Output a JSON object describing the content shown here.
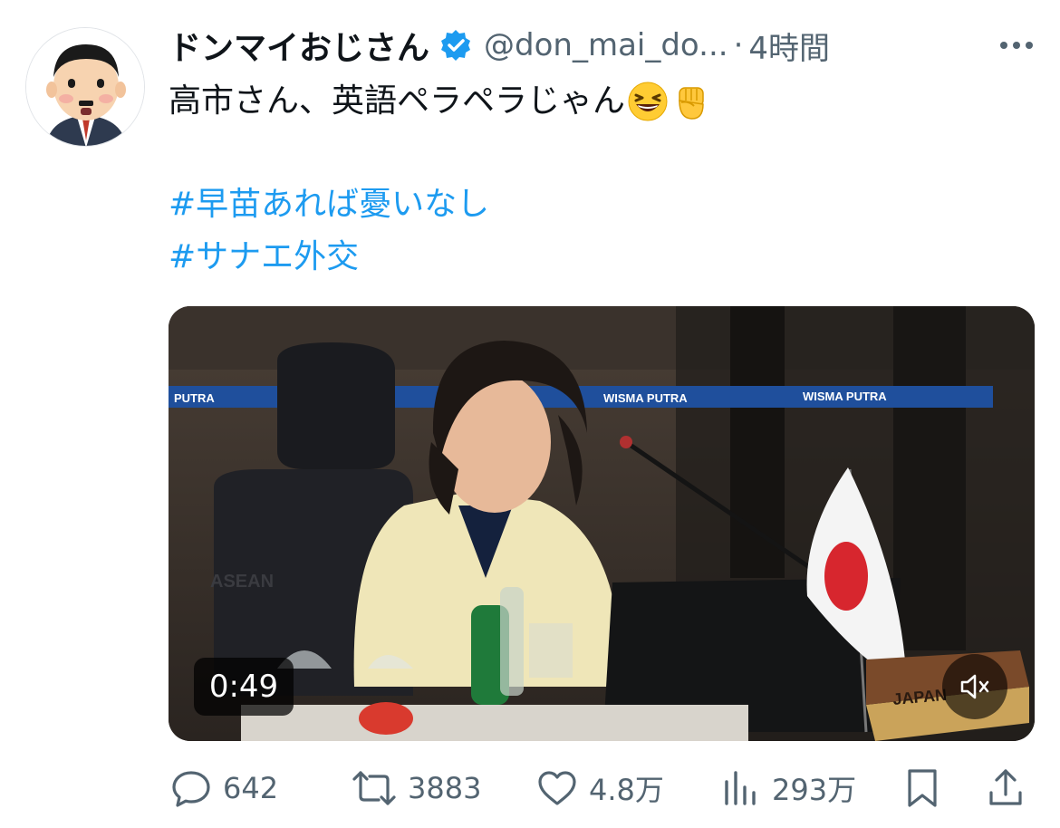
{
  "tweet": {
    "author": {
      "display_name": "ドンマイおじさん",
      "handle": "@don_mai_do...",
      "verified": true,
      "avatar_icon": "cartoon-man-avatar-icon"
    },
    "separator": "·",
    "time": "4時間",
    "text": "高市さん、英語ペラペラじゃん",
    "emojis": [
      "grinning-squinting-face-icon",
      "raised-fist-icon"
    ],
    "hashtags": [
      "#早苗あれば憂いなし",
      "#サナエ外交"
    ],
    "media": {
      "type": "video",
      "duration": "0:49",
      "muted": true,
      "banner_texts": [
        "PUTRA",
        "WISMA PUTRA",
        "WISMA PUTRA"
      ],
      "logo_text": "ASEAN",
      "nameplate": "JAPAN"
    },
    "actions": {
      "replies": "642",
      "retweets": "3883",
      "likes": "4.8万",
      "views": "293万"
    },
    "colors": {
      "link": "#1d9bf0",
      "secondary_text": "#536471",
      "verified": "#1d9bf0"
    }
  }
}
